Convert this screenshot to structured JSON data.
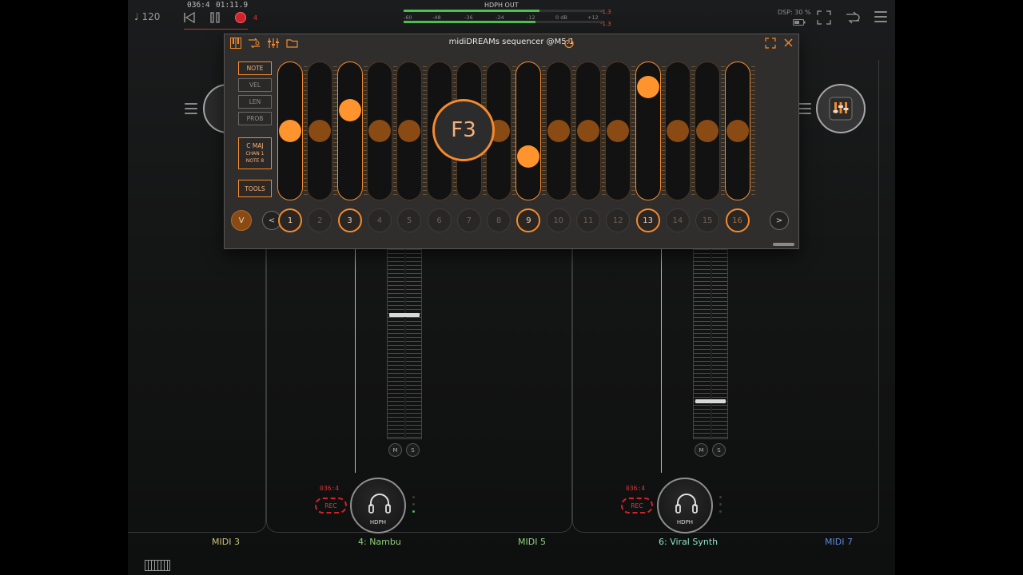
{
  "transport": {
    "tempo": "♩ 120",
    "position": "036:4",
    "time": "01:11.9",
    "record_count": "4"
  },
  "meter": {
    "title": "HDPH OUT",
    "scale": [
      "-60",
      "-48",
      "-36",
      "-24",
      "-12",
      "0 dB",
      "+12"
    ],
    "peak_left": "-1.3",
    "peak_right": "-1.3"
  },
  "dsp": "DSP: 30 %",
  "mixer": {
    "channels": [
      {
        "name": "MIDI 3",
        "color": "#c9c279"
      },
      {
        "name": "4: Nambu",
        "color": "#8fd17a"
      },
      {
        "name": "MIDI 5",
        "color": "#8fd17a"
      },
      {
        "name": "6: Viral Synth",
        "color": "#8fe0c9"
      },
      {
        "name": "MIDI 7",
        "color": "#5f86d6"
      }
    ],
    "output_label": "HDPH",
    "rec_label": "REC",
    "rec_time": "036:4",
    "mute": "M",
    "solo": "S"
  },
  "sequencer": {
    "title": "midiDREAMs sequencer @M5:1",
    "modes": [
      "NOTE",
      "VEL",
      "LEN",
      "PROB"
    ],
    "active_mode": "NOTE",
    "scale": {
      "key": "C MAJ",
      "channel": "CHAN 1",
      "note": "NOTE 8"
    },
    "tools": "TOOLS",
    "current_note": "F3",
    "v_label": "V",
    "prev": "<",
    "next": ">",
    "steps": [
      "1",
      "2",
      "3",
      "4",
      "5",
      "6",
      "7",
      "8",
      "9",
      "10",
      "11",
      "12",
      "13",
      "14",
      "15",
      "16"
    ],
    "active_steps": [
      1,
      3,
      9,
      13
    ],
    "current_step": 16,
    "note_levels": [
      0.5,
      0.5,
      0.68,
      0.5,
      0.5,
      0.5,
      0.5,
      0.5,
      0.28,
      0.5,
      0.5,
      0.5,
      0.88,
      0.5,
      0.5,
      0.5
    ]
  },
  "colors": {
    "accent": "#f58a2d",
    "record": "#e23b3b",
    "meter_green": "#4fbf4f"
  }
}
